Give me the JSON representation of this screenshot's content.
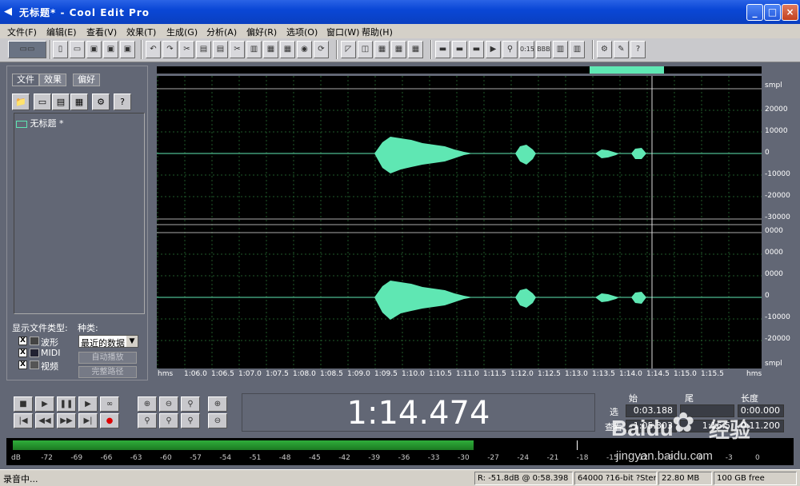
{
  "window": {
    "title": "无标题* - Cool Edit Pro",
    "minimize": "_",
    "maximize": "□",
    "close": "×"
  },
  "menu": [
    "文件(F)",
    "编辑(E)",
    "查看(V)",
    "效果(T)",
    "生成(G)",
    "分析(A)",
    "偏好(R)",
    "选项(O)",
    "窗口(W)",
    "帮助(H)"
  ],
  "left_panel": {
    "tabs": [
      "文件",
      "效果",
      "偏好"
    ],
    "files": [
      "无标题 *"
    ],
    "show_types_label": "显示文件类型:",
    "category_label": "种类:",
    "category_value": "最近的数据",
    "types": [
      {
        "label": "波形",
        "checked": true
      },
      {
        "label": "MIDI",
        "checked": true
      },
      {
        "label": "视频",
        "checked": true
      }
    ],
    "auto_play": "自动播放",
    "full_path": "完整路径"
  },
  "waveform": {
    "y_axis_top": [
      "smpl",
      "20000",
      "10000",
      "0",
      "-10000",
      "-20000",
      "-30000"
    ],
    "y_axis_bottom": [
      "0000",
      "0000",
      "0000",
      "0",
      "-10000",
      "-20000",
      "smpl"
    ],
    "time_axis": [
      "hms",
      "1:06.0",
      "1:06.5",
      "1:07.0",
      "1:07.5",
      "1:08.0",
      "1:08.5",
      "1:09.0",
      "1:09.5",
      "1:10.0",
      "1:10.5",
      "1:11.0",
      "1:11.5",
      "1:12.0",
      "1:12.5",
      "1:13.0",
      "1:13.5",
      "1:14.0",
      "1:14.5",
      "1:15.0",
      "1:15.5",
      "hms"
    ],
    "wave_color": "#5fe7b3",
    "grid_color": "#1f5a2a"
  },
  "time_display": "1:14.474",
  "selection": {
    "col_start": "始",
    "col_end": "尾",
    "col_length": "长度",
    "row_sel": "选",
    "row_view": "查看",
    "sel_start": "0:03.188",
    "sel_length": "0:00.000",
    "view_start": "1:05.303",
    "view_end": "1:16.5",
    "view_length": "0:11.200"
  },
  "level_meter": {
    "ticks": [
      "dB",
      "-72",
      "-69",
      "-66",
      "-63",
      "-60",
      "-57",
      "-54",
      "-51",
      "-48",
      "-45",
      "-42",
      "-39",
      "-36",
      "-33",
      "-30",
      "-27",
      "-24",
      "-21",
      "-18",
      "-15",
      "-12",
      "-9",
      "-6",
      "-3",
      "0"
    ],
    "level_fraction": 0.595
  },
  "status": {
    "left": "录音中...",
    "level": "R: -51.8dB @   0:58.398",
    "format": "64000 ?16-bit ?Stereo",
    "size": "22.80 MB",
    "free": "100 GB free"
  },
  "watermark": {
    "logo": "Baidu",
    "logo_cn": "经验",
    "url": "jingyan.baidu.com"
  }
}
